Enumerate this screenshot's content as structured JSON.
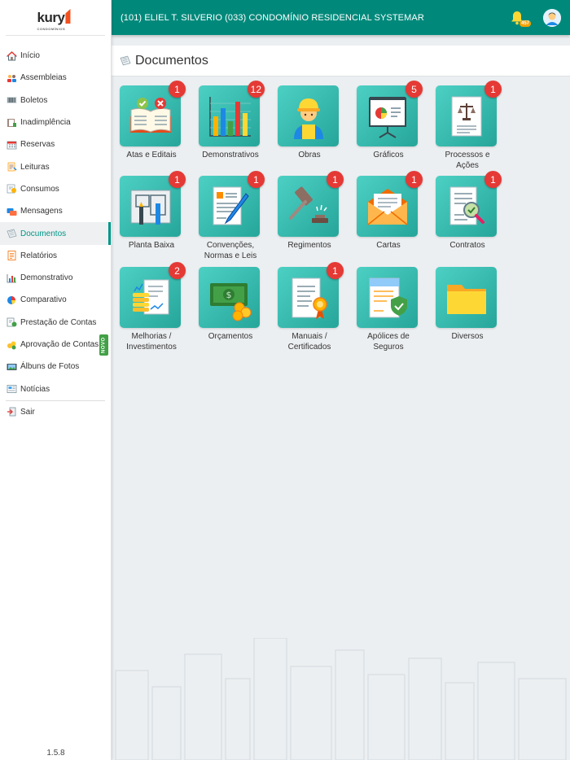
{
  "header": {
    "title": "(101) ELIEL T. SILVERIO  (033) CONDOMÍNIO RESIDENCIAL SYSTEMAR",
    "notification_count": "457"
  },
  "logo": {
    "text": "kury",
    "sub": "CONDOMÍNIOS"
  },
  "sidebar": {
    "items": [
      {
        "label": "Início",
        "icon": "home-icon"
      },
      {
        "label": "Assembleias",
        "icon": "people-icon"
      },
      {
        "label": "Boletos",
        "icon": "barcode-icon"
      },
      {
        "label": "Inadimplência",
        "icon": "ledger-icon"
      },
      {
        "label": "Reservas",
        "icon": "calendar-icon"
      },
      {
        "label": "Leituras",
        "icon": "meter-icon"
      },
      {
        "label": "Consumos",
        "icon": "consumption-icon"
      },
      {
        "label": "Mensagens",
        "icon": "messages-icon"
      },
      {
        "label": "Documentos",
        "icon": "documents-icon"
      },
      {
        "label": "Relatórios",
        "icon": "report-icon"
      },
      {
        "label": "Demonstrativo",
        "icon": "bar-chart-icon"
      },
      {
        "label": "Comparativo",
        "icon": "pie-chart-icon"
      },
      {
        "label": "Prestação de Contas",
        "icon": "accounts-icon"
      },
      {
        "label": "Aprovação de Contas",
        "icon": "coins-icon"
      },
      {
        "label": "Álbuns de Fotos",
        "icon": "photo-icon"
      },
      {
        "label": "Notícias",
        "icon": "news-icon"
      },
      {
        "label": "Sair",
        "icon": "exit-icon"
      }
    ],
    "active": "Documentos",
    "novo_label": "NOVO",
    "version": "1.5.8"
  },
  "page": {
    "title": "Documentos"
  },
  "tiles": [
    {
      "label": "Atas e Editais",
      "badge": "1"
    },
    {
      "label": "Demonstrativos",
      "badge": "12"
    },
    {
      "label": "Obras",
      "badge": ""
    },
    {
      "label": "Gráficos",
      "badge": "5"
    },
    {
      "label": "Processos e Ações",
      "badge": "1"
    },
    {
      "label": "Planta Baixa",
      "badge": "1"
    },
    {
      "label": "Convenções, Normas e Leis",
      "badge": "1"
    },
    {
      "label": "Regimentos",
      "badge": "1"
    },
    {
      "label": "Cartas",
      "badge": "1"
    },
    {
      "label": "Contratos",
      "badge": "1"
    },
    {
      "label": "Melhorias / Investimentos",
      "badge": "2"
    },
    {
      "label": "Orçamentos",
      "badge": ""
    },
    {
      "label": "Manuais / Certificados",
      "badge": "1"
    },
    {
      "label": "Apólices de Seguros",
      "badge": ""
    },
    {
      "label": "Diversos",
      "badge": ""
    }
  ],
  "colors": {
    "primary": "#00897b",
    "tile": "#26a69a",
    "badge": "#e53935",
    "novo": "#43a047"
  }
}
